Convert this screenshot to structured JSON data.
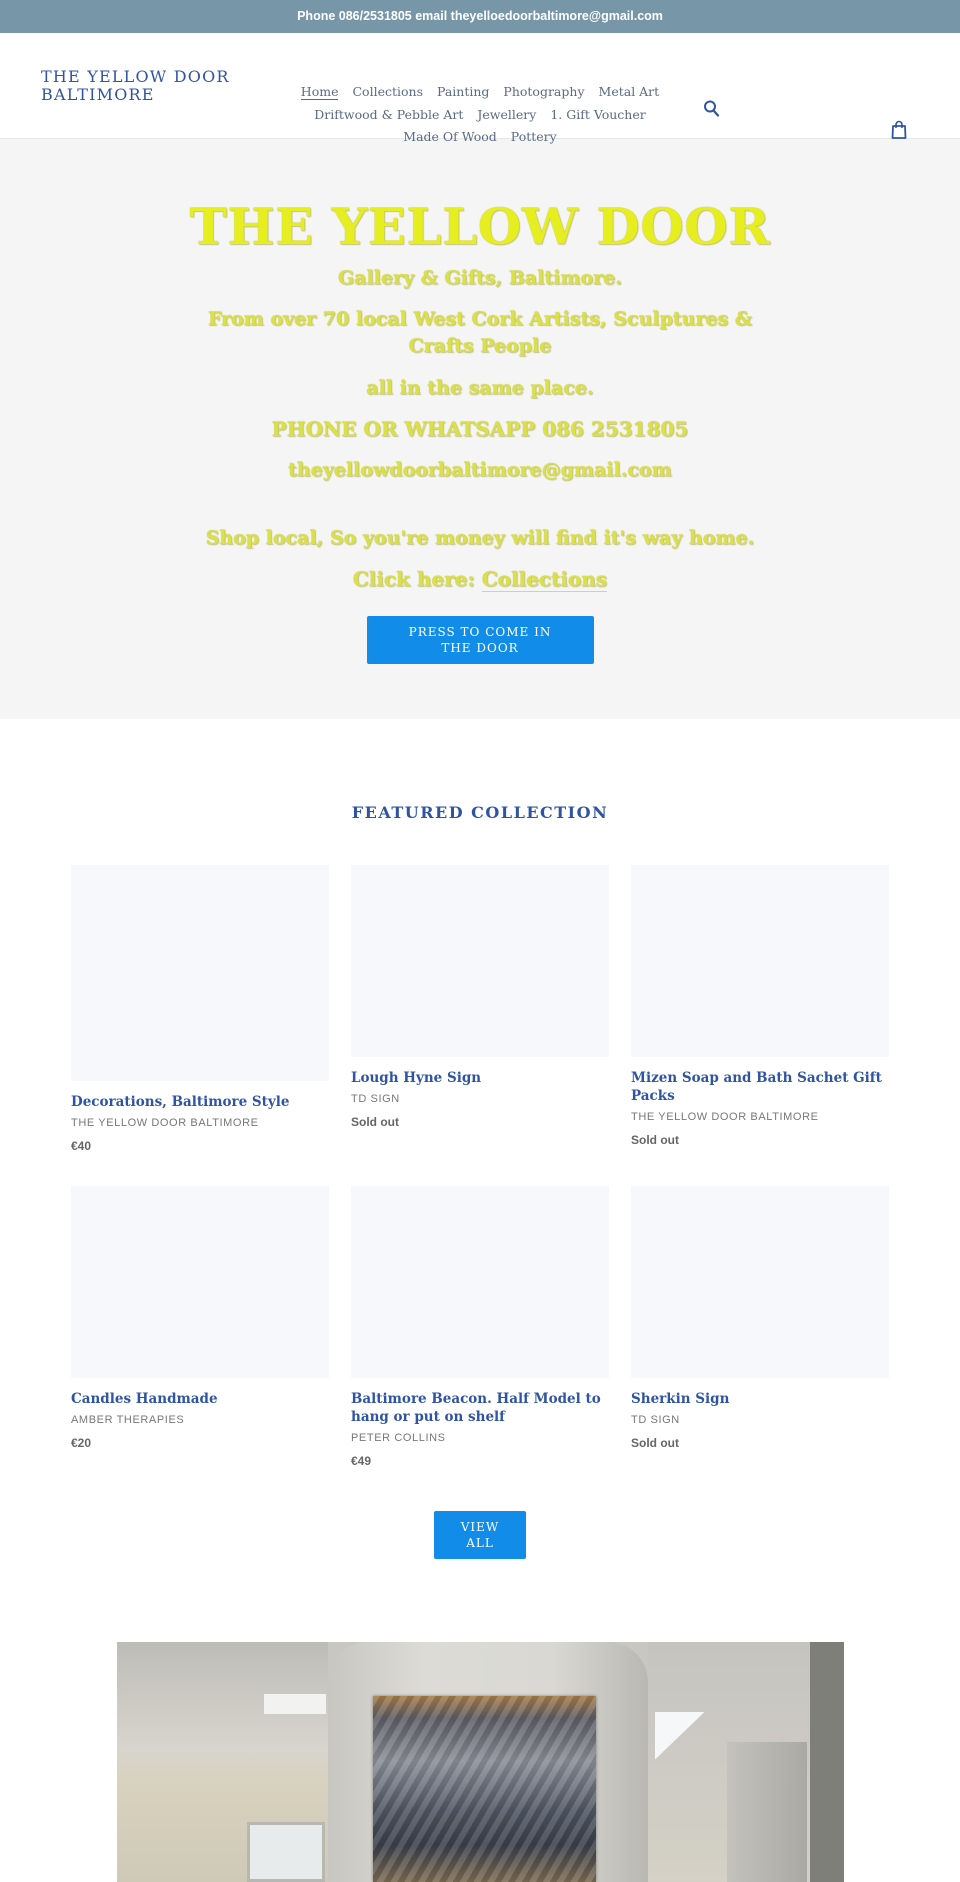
{
  "announcement": "Phone 086/2531805 email theyelloedoorbaltimore@gmail.com",
  "header": {
    "logo": "THE YELLOW DOOR BALTIMORE",
    "nav": [
      {
        "label": "Home",
        "active": true
      },
      {
        "label": "Collections"
      },
      {
        "label": "Painting"
      },
      {
        "label": "Photography"
      },
      {
        "label": "Metal Art"
      },
      {
        "label": "Driftwood & Pebble Art"
      },
      {
        "label": "Jewellery"
      },
      {
        "label": "1. Gift Voucher"
      },
      {
        "label": "Made Of Wood"
      },
      {
        "label": "Pottery"
      }
    ],
    "search_icon": "search-icon",
    "cart_icon": "shopping-bag-icon"
  },
  "hero": {
    "title": "THE YELLOW DOOR",
    "subtitle": "Gallery & Gifts, Baltimore.",
    "artists_line": "From over 70 local West Cork Artists, Sculptures & Crafts People",
    "same_place": "all in the same place.",
    "phone": "PHONE OR WHATSAPP 086 2531805",
    "email": "theyellowdoorbaltimore@gmail.com",
    "shop_local": "Shop local, So you're money will find it's way home.",
    "click_here": "Click here: ",
    "collections_link": "Collections",
    "button": "PRESS TO COME IN THE DOOR",
    "text_color": "#e1ea1c"
  },
  "featured": {
    "title": "FEATURED COLLECTION",
    "products": [
      {
        "title": "Decorations, Baltimore Style",
        "vendor": "THE YELLOW DOOR BALTIMORE",
        "price": "€40"
      },
      {
        "title": "Lough Hyne Sign",
        "vendor": "TD SIGN",
        "price": "Sold out"
      },
      {
        "title": "Mizen Soap and Bath Sachet Gift Packs",
        "vendor": "THE YELLOW DOOR BALTIMORE",
        "price": "Sold out"
      },
      {
        "title": "Candles Handmade",
        "vendor": "AMBER THERAPIES",
        "price": "€20"
      },
      {
        "title": "Baltimore Beacon. Half Model to hang or put on shelf",
        "vendor": "PETER COLLINS",
        "price": "€49"
      },
      {
        "title": "Sherkin Sign",
        "vendor": "TD SIGN",
        "price": "Sold out"
      }
    ],
    "view_all": "VIEW ALL"
  },
  "colors": {
    "announcement_bg": "#7796a8",
    "brand_blue": "#3054a4",
    "button_blue": "#118de9",
    "hero_bg": "#f5f5f5",
    "placeholder_bg": "#f7f8fc"
  }
}
